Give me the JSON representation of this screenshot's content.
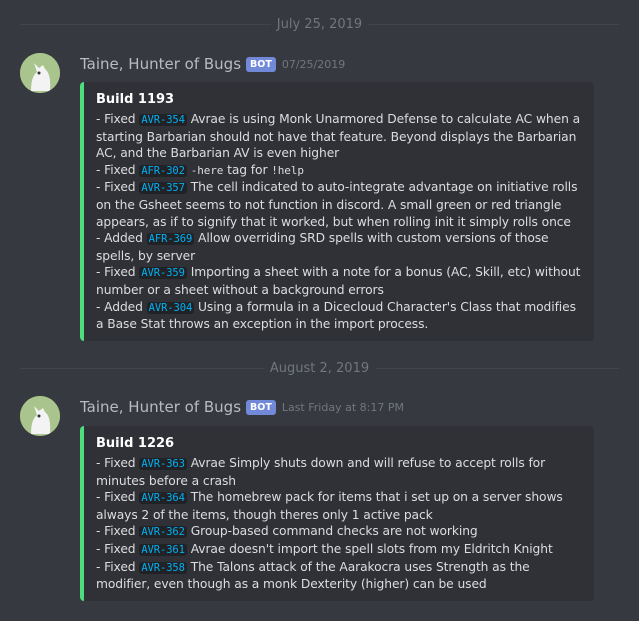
{
  "dividers": [
    "July 25, 2019",
    "August 2, 2019"
  ],
  "messages": [
    {
      "author": "Taine, Hunter of Bugs",
      "bot_badge": "BOT",
      "timestamp": "07/25/2019",
      "embed": {
        "accent_color": "#4fdc7c",
        "title": "Build 1193",
        "entries": [
          {
            "prefix": "- Fixed ",
            "ticket": "AVR-354",
            "text": " Avrae is using Monk Unarmored Defense to calculate AC when a starting Barbarian should not have that feature. Beyond displays the Barbarian AC, and the Barbarian AV is even higher"
          },
          {
            "prefix": "- Fixed ",
            "ticket": "AFR-302",
            "text1": " ",
            "code1": "-here",
            "text2": " tag for ",
            "code2": "!help"
          },
          {
            "prefix": "- Fixed ",
            "ticket": "AVR-357",
            "text": " The cell indicated to auto-integrate advantage on initiative rolls on the Gsheet seems to not function in discord. A small green or red triangle appears, as if to signify that it worked, but when rolling init it simply rolls once"
          },
          {
            "prefix": "- Added ",
            "ticket": "AFR-369",
            "text": " Allow overriding SRD spells with custom versions of those spells, by server"
          },
          {
            "prefix": "- Fixed ",
            "ticket": "AVR-359",
            "text": " Importing a sheet with a note for a bonus (AC, Skill, etc) without number or a sheet without a background errors"
          },
          {
            "prefix": "- Added ",
            "ticket": "AVR-304",
            "text": " Using a formula in a Dicecloud Character's Class that modifies a Base Stat throws an exception in the import process."
          }
        ]
      }
    },
    {
      "author": "Taine, Hunter of Bugs",
      "bot_badge": "BOT",
      "timestamp": "Last Friday at 8:17 PM",
      "embed": {
        "accent_color": "#4fdc7c",
        "title": "Build 1226",
        "entries": [
          {
            "prefix": "- Fixed ",
            "ticket": "AVR-363",
            "text": " Avrae Simply shuts down and will refuse to accept rolls for minutes before a crash"
          },
          {
            "prefix": "- Fixed ",
            "ticket": "AVR-364",
            "text": " The homebrew pack for items that i set up on a server shows always 2 of the items, though theres only 1 active pack"
          },
          {
            "prefix": "- Fixed ",
            "ticket": "AVR-362",
            "text": " Group-based command checks are not working"
          },
          {
            "prefix": "- Fixed ",
            "ticket": "AVR-361",
            "text": " Avrae doesn't import the spell slots from my Eldritch Knight"
          },
          {
            "prefix": "- Fixed ",
            "ticket": "AVR-358",
            "text": " The Talons attack of the Aarakocra uses Strength as the modifier, even though as a monk Dexterity (higher) can be used"
          }
        ]
      }
    }
  ]
}
